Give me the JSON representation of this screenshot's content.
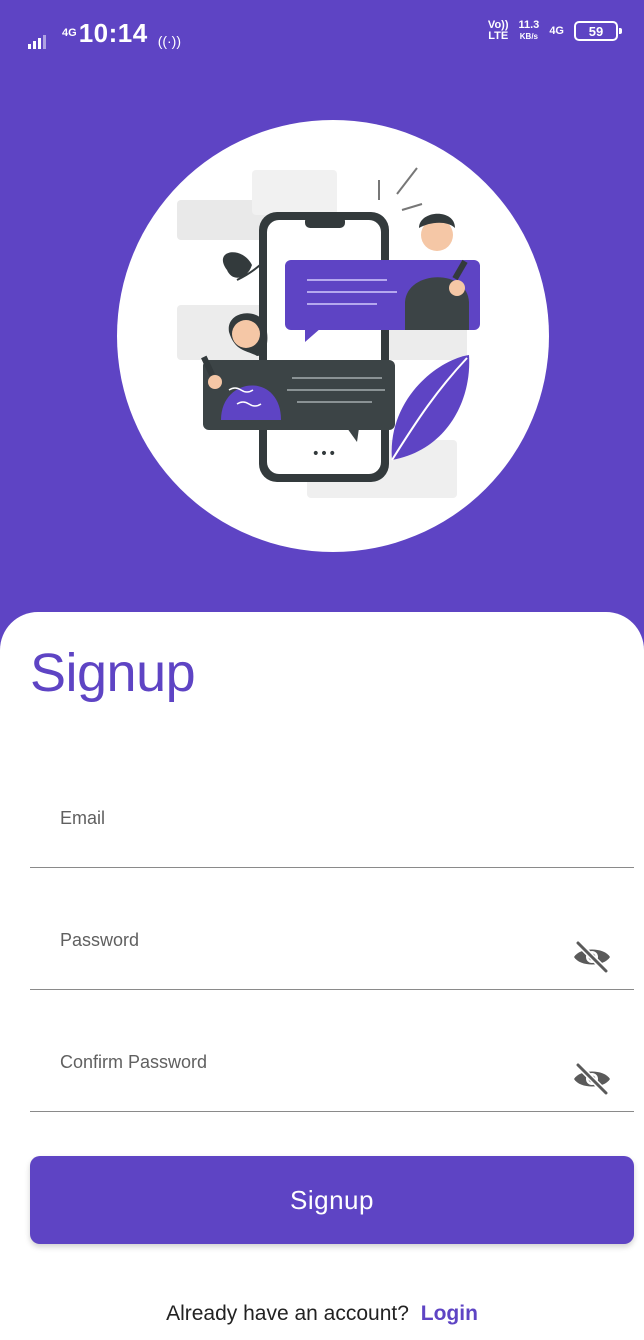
{
  "status_bar": {
    "network": "4G",
    "time": "10:14",
    "volte_line1": "Vo))",
    "volte_line2": "LTE",
    "speed_value": "11.3",
    "speed_unit": "KB/s",
    "network_right": "4G",
    "battery": "59"
  },
  "signup": {
    "title": "Signup",
    "email_placeholder": "Email",
    "password_placeholder": "Password",
    "confirm_placeholder": "Confirm Password",
    "submit_label": "Signup",
    "footer_text": "Already have an account?",
    "login_label": "Login"
  },
  "icons": {
    "toggle_password": "eye-off-icon",
    "toggle_confirm": "eye-off-icon"
  },
  "colors": {
    "primary": "#5e44c4",
    "background": "#ffffff",
    "text": "#222222",
    "divider": "#8a8a8a"
  }
}
